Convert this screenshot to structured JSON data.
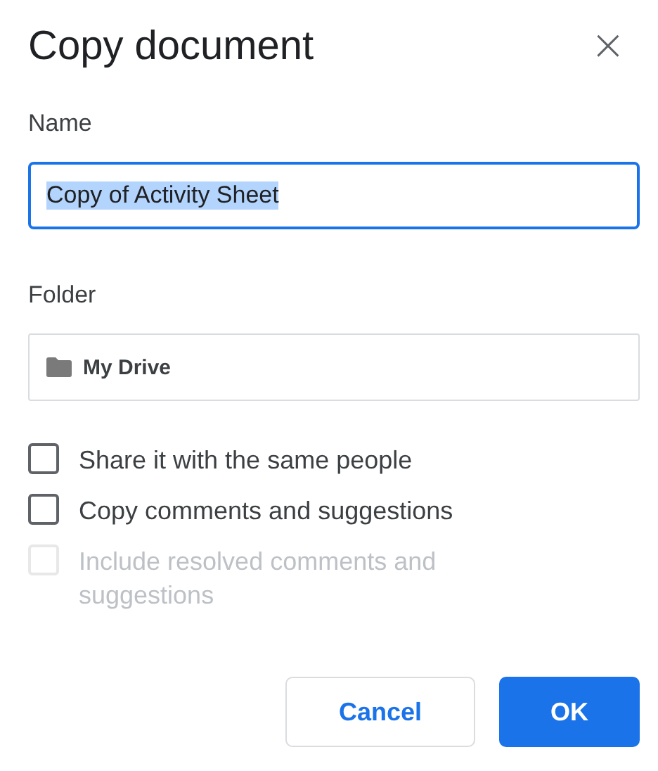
{
  "dialog": {
    "title": "Copy document",
    "close": "×"
  },
  "name_field": {
    "label": "Name",
    "value": "Copy of Activity Sheet",
    "focused": true,
    "text_selected": true
  },
  "folder_field": {
    "label": "Folder",
    "value": "My Drive"
  },
  "options": [
    {
      "label": "Share it with the same people",
      "checked": false,
      "disabled": false
    },
    {
      "label": "Copy comments and suggestions",
      "checked": false,
      "disabled": false
    },
    {
      "label": "Include resolved comments and suggestions",
      "checked": false,
      "disabled": true
    }
  ],
  "buttons": [
    {
      "label": "Cancel",
      "kind": "secondary"
    },
    {
      "label": "OK",
      "kind": "primary"
    }
  ]
}
